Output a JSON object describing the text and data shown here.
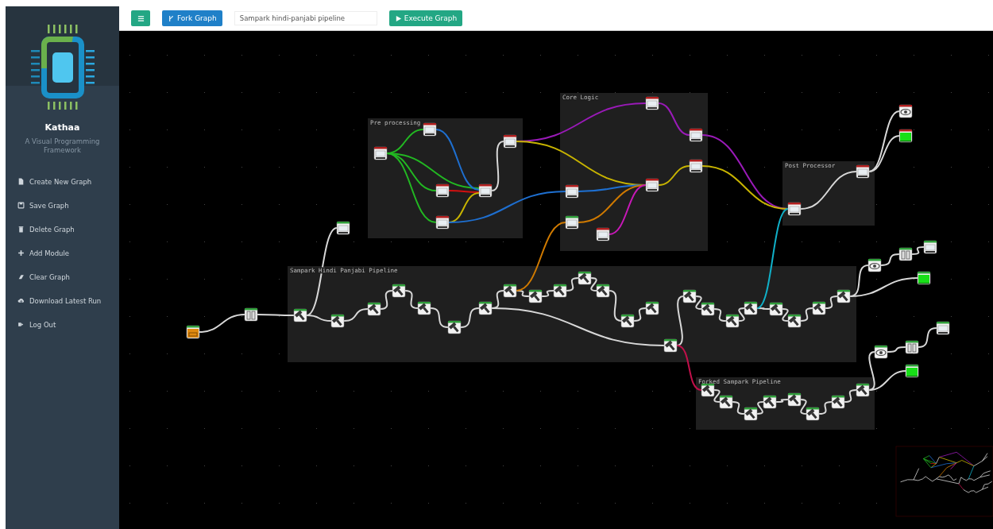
{
  "sidebar": {
    "app_name": "Kathaa",
    "tagline": "A Visual Programming Framework",
    "items": [
      {
        "kind": "new",
        "label": "Create New Graph"
      },
      {
        "kind": "save",
        "label": "Save Graph"
      },
      {
        "kind": "delete",
        "label": "Delete Graph"
      },
      {
        "kind": "add",
        "label": "Add Module"
      },
      {
        "kind": "clear",
        "label": "Clear Graph"
      },
      {
        "kind": "download",
        "label": "Download Latest Run"
      },
      {
        "kind": "logout",
        "label": "Log Out"
      }
    ]
  },
  "toolbar": {
    "fork_button": "Fork Graph",
    "graph_name": "Sampark hindi-panjabi pipeline",
    "execute_button": "Execute Graph"
  },
  "canvas": {
    "groups": [
      {
        "title": "Pre processing"
      },
      {
        "title": "Core Logic"
      },
      {
        "title": "Post Processor"
      },
      {
        "title": "Sampark Hindi Panjabi Pipeline"
      },
      {
        "title": "Forked Sampark Pipeline"
      }
    ],
    "nodes": [
      {
        "kind": "monitor",
        "color": "#b01e1e"
      },
      {
        "kind": "monitor",
        "color": "#b01e1e"
      },
      {
        "kind": "monitor",
        "color": "#b01e1e"
      },
      {
        "kind": "monitor",
        "color": "#b01e1e"
      },
      {
        "kind": "monitor",
        "color": "#b01e1e"
      },
      {
        "kind": "monitor",
        "color": "#b01e1e"
      },
      {
        "kind": "monitor",
        "color": "#b01e1e"
      },
      {
        "kind": "monitor",
        "color": "#2f9e3a"
      },
      {
        "kind": "monitor",
        "color": "#b01e1e"
      },
      {
        "kind": "monitor",
        "color": "#b01e1e"
      },
      {
        "kind": "monitor",
        "color": "#b01e1e"
      },
      {
        "kind": "monitor",
        "color": "#b01e1e"
      },
      {
        "kind": "monitor",
        "color": "#b01e1e"
      },
      {
        "kind": "monitor",
        "color": "#b01e1e"
      },
      {
        "kind": "monitor",
        "color": "#b01e1e"
      },
      {
        "kind": "eye",
        "color": "#b01e1e"
      },
      {
        "kind": "screen",
        "color": "#b01e1e"
      },
      {
        "kind": "source",
        "color": "#2f9e3a"
      },
      {
        "kind": "pause",
        "color": "#2f9e3a"
      },
      {
        "kind": "monitor",
        "color": "#2f9e3a"
      },
      {
        "kind": "hammer",
        "color": "#2f9e3a"
      },
      {
        "kind": "hammer",
        "color": "#2f9e3a"
      },
      {
        "kind": "hammer",
        "color": "#2f9e3a"
      },
      {
        "kind": "hammer",
        "color": "#2f9e3a"
      },
      {
        "kind": "hammer",
        "color": "#2f9e3a"
      },
      {
        "kind": "hammer",
        "color": "#2f9e3a"
      },
      {
        "kind": "hammer",
        "color": "#2f9e3a"
      },
      {
        "kind": "hammer",
        "color": "#2f9e3a"
      },
      {
        "kind": "hammer",
        "color": "#2f9e3a"
      },
      {
        "kind": "hammer",
        "color": "#2f9e3a"
      },
      {
        "kind": "hammer",
        "color": "#2f9e3a"
      },
      {
        "kind": "hammer",
        "color": "#2f9e3a"
      },
      {
        "kind": "hammer",
        "color": "#2f9e3a"
      },
      {
        "kind": "hammer",
        "color": "#2f9e3a"
      },
      {
        "kind": "hammer",
        "color": "#2f9e3a"
      },
      {
        "kind": "hammer",
        "color": "#2f9e3a"
      },
      {
        "kind": "hammer",
        "color": "#2f9e3a"
      },
      {
        "kind": "hammer",
        "color": "#2f9e3a"
      },
      {
        "kind": "hammer",
        "color": "#2f9e3a"
      },
      {
        "kind": "hammer",
        "color": "#2f9e3a"
      },
      {
        "kind": "hammer",
        "color": "#2f9e3a"
      },
      {
        "kind": "hammer",
        "color": "#2f9e3a"
      },
      {
        "kind": "hammer",
        "color": "#2f9e3a"
      },
      {
        "kind": "eye",
        "color": "#2f9e3a"
      },
      {
        "kind": "pause",
        "color": "#2f9e3a"
      },
      {
        "kind": "monitor",
        "color": "#2f9e3a"
      },
      {
        "kind": "screen",
        "color": "#2f9e3a"
      },
      {
        "kind": "hammer",
        "color": "#2f9e3a"
      },
      {
        "kind": "hammer",
        "color": "#2f9e3a"
      },
      {
        "kind": "hammer",
        "color": "#2f9e3a"
      },
      {
        "kind": "hammer",
        "color": "#2f9e3a"
      },
      {
        "kind": "hammer",
        "color": "#2f9e3a"
      },
      {
        "kind": "hammer",
        "color": "#2f9e3a"
      },
      {
        "kind": "hammer",
        "color": "#2f9e3a"
      },
      {
        "kind": "hammer",
        "color": "#2f9e3a"
      },
      {
        "kind": "eye",
        "color": "#2f9e3a"
      },
      {
        "kind": "pause",
        "color": "#2f9e3a"
      },
      {
        "kind": "monitor",
        "color": "#2f9e3a"
      },
      {
        "kind": "screen",
        "color": "#2f9e3a"
      }
    ],
    "edges": [
      {
        "color": "#22b822"
      },
      {
        "color": "#22b822"
      },
      {
        "color": "#22b822"
      },
      {
        "color": "#22b822"
      },
      {
        "color": "#1e6fd0"
      },
      {
        "color": "#d01010"
      },
      {
        "color": "#c8b400"
      },
      {
        "color": "#1e6fd0"
      },
      {
        "color": "#d8d8d8"
      },
      {
        "color": "#9a1ab8"
      },
      {
        "color": "#c8b400"
      },
      {
        "color": "#1e6fd0"
      },
      {
        "color": "#d07a00"
      },
      {
        "color": "#c818b8"
      },
      {
        "color": "#9a1ab8"
      },
      {
        "color": "#c8b400"
      },
      {
        "color": "#9a1ab8"
      },
      {
        "color": "#c8b400"
      },
      {
        "color": "#d8d8d8"
      },
      {
        "color": "#d8d8d8"
      },
      {
        "color": "#d8d8d8"
      },
      {
        "color": "#d8d8d8"
      },
      {
        "color": "#d8d8d8"
      },
      {
        "color": "#d8d8d8"
      },
      {
        "color": "#d8d8d8"
      },
      {
        "color": "#d8d8d8"
      },
      {
        "color": "#d8d8d8"
      },
      {
        "color": "#d8d8d8"
      },
      {
        "color": "#d8d8d8"
      },
      {
        "color": "#d8d8d8"
      },
      {
        "color": "#d8d8d8"
      },
      {
        "color": "#d8d8d8"
      },
      {
        "color": "#d8d8d8"
      },
      {
        "color": "#d8d8d8"
      },
      {
        "color": "#d8d8d8"
      },
      {
        "color": "#d8d8d8"
      },
      {
        "color": "#d8d8d8"
      },
      {
        "color": "#d8d8d8"
      },
      {
        "color": "#d8d8d8"
      },
      {
        "color": "#d8d8d8"
      },
      {
        "color": "#d8d8d8"
      },
      {
        "color": "#d8d8d8"
      },
      {
        "color": "#d8d8d8"
      },
      {
        "color": "#d8d8d8"
      },
      {
        "color": "#d8d8d8"
      },
      {
        "color": "#d8d8d8"
      },
      {
        "color": "#d07a00"
      },
      {
        "color": "#10b0c8"
      },
      {
        "color": "#d8d8d8"
      },
      {
        "color": "#d8d8d8"
      },
      {
        "color": "#d8d8d8"
      },
      {
        "color": "#d8d8d8"
      },
      {
        "color": "#c0104a"
      },
      {
        "color": "#d8d8d8"
      },
      {
        "color": "#d8d8d8"
      },
      {
        "color": "#d8d8d8"
      },
      {
        "color": "#d8d8d8"
      },
      {
        "color": "#d8d8d8"
      },
      {
        "color": "#d8d8d8"
      },
      {
        "color": "#d8d8d8"
      },
      {
        "color": "#d8d8d8"
      },
      {
        "color": "#d8d8d8"
      },
      {
        "color": "#d8d8d8"
      },
      {
        "color": "#d8d8d8"
      }
    ]
  }
}
